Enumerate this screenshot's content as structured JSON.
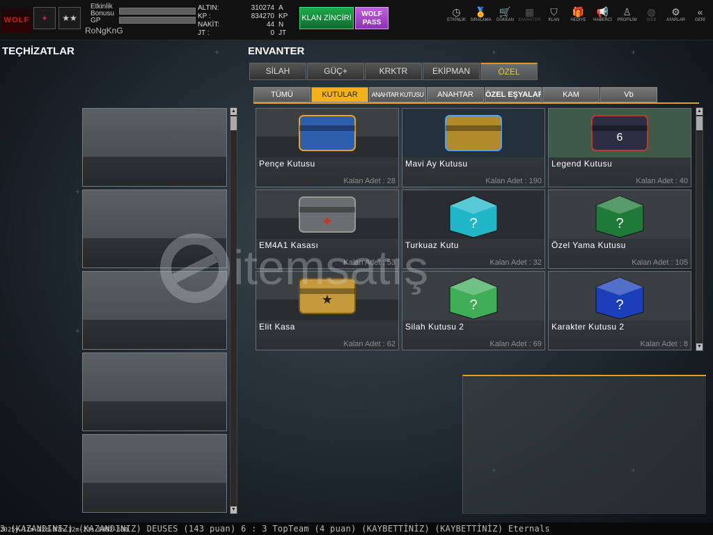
{
  "player": {
    "etkinlik_label": "Etkinlik Bonusu",
    "gp_label": "GP",
    "nickname": "RoNgKnG",
    "logo_text": "WOLF"
  },
  "currency": [
    {
      "label": "ALTIN:",
      "value": "310274",
      "unit": "A"
    },
    {
      "label": "KP :",
      "value": "834270",
      "unit": "KP"
    },
    {
      "label": "NAKİT:",
      "value": "44",
      "unit": "N"
    },
    {
      "label": "JT :",
      "value": "0",
      "unit": "JT"
    }
  ],
  "buttons": {
    "klan": "KLAN ZİNCİRİ",
    "wolf": "WOLF PASS"
  },
  "nav": [
    {
      "label": "ETKİNLİK",
      "icon": "clock-icon",
      "glyph": "◷",
      "dim": false
    },
    {
      "label": "SIRALAMA",
      "icon": "medal-icon",
      "glyph": "🏅",
      "dim": false
    },
    {
      "label": "DÜKKAN",
      "icon": "cart-icon",
      "glyph": "🛒",
      "dim": false
    },
    {
      "label": "ENVANTER",
      "icon": "inventory-icon",
      "glyph": "▦",
      "dim": true
    },
    {
      "label": "KLAN",
      "icon": "clan-shield-icon",
      "glyph": "⛉",
      "dim": false
    },
    {
      "label": "HEDİYE",
      "icon": "gift-icon",
      "glyph": "🎁",
      "dim": false
    },
    {
      "label": "HABERCİ",
      "icon": "megaphone-icon",
      "glyph": "📢",
      "dim": false
    },
    {
      "label": "PROFİLİM",
      "icon": "profile-icon",
      "glyph": "♙",
      "dim": false
    },
    {
      "label": "WEB",
      "icon": "globe-icon",
      "glyph": "◍",
      "dim": true
    },
    {
      "label": "AYARLAR",
      "icon": "gear-icon",
      "glyph": "⚙",
      "dim": false
    },
    {
      "label": "GERİ",
      "icon": "back-icon",
      "glyph": "«",
      "dim": false
    }
  ],
  "headings": {
    "left": "TEÇHİZATLAR",
    "right": "ENVANTER"
  },
  "tabs_main": [
    "SİLAH",
    "GÜÇ+",
    "KRKTR",
    "EKİPMAN",
    "ÖZEL"
  ],
  "tabs_main_active": 4,
  "tabs_sub": [
    "TÜMÜ",
    "KUTULAR",
    "ANAHTAR KUTUSU",
    "ANAHTAR",
    "ÖZEL EŞYALAR",
    "KAM",
    "Vb"
  ],
  "tabs_sub_active": 1,
  "items": [
    {
      "name": "Pençe Kutusu",
      "count": "Kalan Adet : 28",
      "art": "blue-crate"
    },
    {
      "name": "Mavi Ay Kutusu",
      "count": "Kalan Adet : 190",
      "art": "gold-crate"
    },
    {
      "name": "Legend Kutusu",
      "count": "Kalan Adet : 40",
      "art": "legend-crate"
    },
    {
      "name": "EM4A1 Kasası",
      "count": "Kalan Adet : 53",
      "art": "grey-crate"
    },
    {
      "name": "Turkuaz Kutu",
      "count": "Kalan Adet : 32",
      "art": "turquoise-box"
    },
    {
      "name": "Özel Yama Kutusu",
      "count": "Kalan Adet : 105",
      "art": "gift-box"
    },
    {
      "name": "Elit Kasa",
      "count": "Kalan Adet : 62",
      "art": "gold-star-crate"
    },
    {
      "name": "Silah Kutusu 2",
      "count": "Kalan Adet : 69",
      "art": "green-box"
    },
    {
      "name": "Karakter Kutusu 2",
      "count": "Kalan Adet : 8",
      "art": "blue-box"
    }
  ],
  "ticker": "3 (KAZANDINIZ)    (KAZANDINIZ) DEUSES (143 puan) 6 : 3 TopTeam (4 puan) (KAYBETTİNİZ)      (KAYBETTİNİZ) Eternals",
  "timestamp": "2025y-11m-22d-07h-12m-23s-0892-630",
  "colors": {
    "accent": "#f3b21a",
    "tab_active_text": "#f3c23a",
    "klan_green": "#1fa84a",
    "wolf_purple": "#c25de0"
  }
}
